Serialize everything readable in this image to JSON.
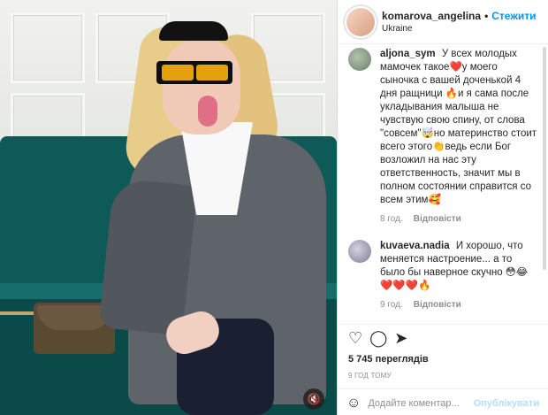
{
  "post": {
    "username": "komarova_angelina",
    "follow_label": "Стежити",
    "location": "Ukraine",
    "views_label": "5 745 переглядів",
    "time_ago": "9 ГОД ТОМУ",
    "add_comment_placeholder": "Додайте коментар...",
    "publish_label": "Опублікувати"
  },
  "comments": [
    {
      "user": "aljona_sym",
      "text": "У всех молодых мамочек такое❤️у моего сыночка с вашей доченькой 4 дня ращници 🔥и я сама после укладывания малыша не чувствую свою спину, от слова \"совсем\"🤯но материнство стоит всего этого👏ведь если Бог возложил на нас эту ответственность, значит мы в полном состоянии справится со всем этим🥰",
      "age": "8 год.",
      "reply_label": "Відповісти"
    },
    {
      "user": "kuvaeva.nadia",
      "text": "И хорошо, что меняется настроение... а то было бы наверное скучно 😳😂❤️❤️❤️🔥",
      "age": "9 год.",
      "reply_label": "Відповісти"
    }
  ],
  "icons": {
    "like": "heart-icon",
    "comment": "comment-icon",
    "share": "share-icon",
    "mute": "mute-icon",
    "emoji": "emoji-icon"
  },
  "colors": {
    "follow": "#0095f6",
    "publish_disabled": "#b2dffc"
  }
}
